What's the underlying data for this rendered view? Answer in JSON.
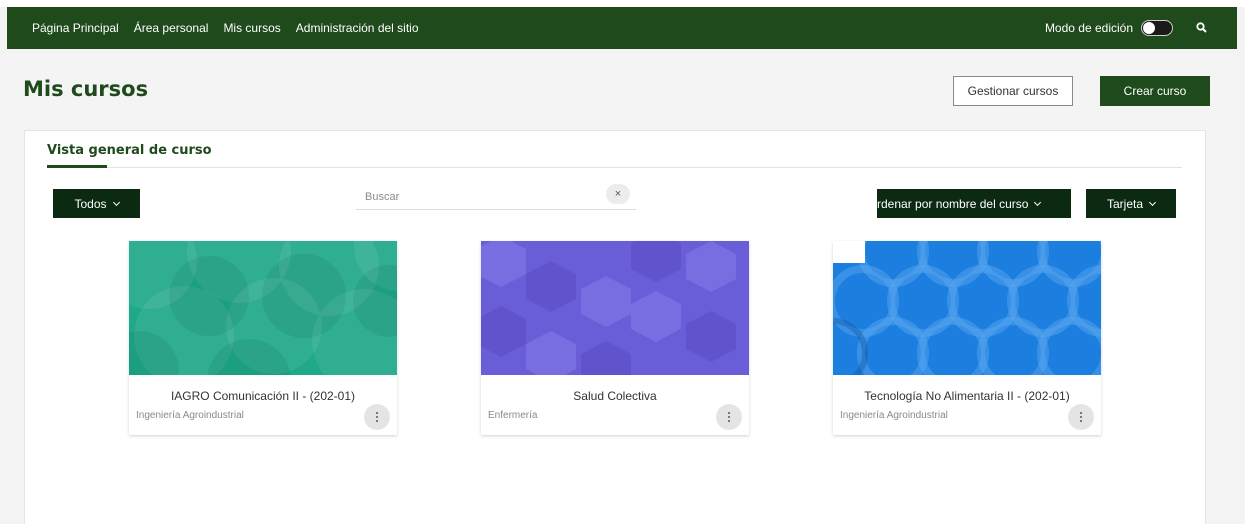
{
  "nav": {
    "links": [
      "Página Principal",
      "Área personal",
      "Mis cursos",
      "Administración del sitio"
    ],
    "edit_mode_label": "Modo de edición"
  },
  "header": {
    "title": "Mis cursos",
    "manage_label": "Gestionar cursos",
    "create_label": "Crear curso"
  },
  "overview": {
    "title": "Vista general de curso",
    "filter_label": "Todos",
    "search_placeholder": "Buscar",
    "clear_symbol": "×",
    "sort_label": "rdenar por nombre del curso",
    "view_label": "Tarjeta"
  },
  "courses": [
    {
      "name": "IAGRO Comunicación II - (202-01)",
      "category": "Ingeniería Agroindustrial",
      "color": "#1fa889"
    },
    {
      "name": "Salud Colectiva",
      "category": "Enfermería",
      "color": "#6a5ed8"
    },
    {
      "name": "Tecnología No Alimentaria II - (202-01)",
      "category": "Ingeniería Agroindustrial",
      "color": "#1c7fe0"
    }
  ]
}
